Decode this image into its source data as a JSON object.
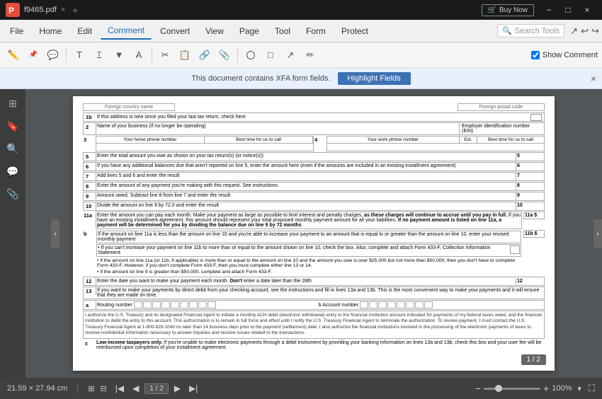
{
  "titleBar": {
    "appName": "f9465.pdf",
    "buyNowLabel": "Buy Now",
    "closeTab": "×",
    "newTab": "+",
    "minLabel": "−",
    "maxLabel": "□",
    "closeLabel": "×"
  },
  "menuBar": {
    "items": [
      {
        "id": "file",
        "label": "File"
      },
      {
        "id": "home",
        "label": "Home"
      },
      {
        "id": "edit",
        "label": "Edit"
      },
      {
        "id": "comment",
        "label": "Comment",
        "active": true
      },
      {
        "id": "convert",
        "label": "Convert"
      },
      {
        "id": "view",
        "label": "View"
      },
      {
        "id": "page",
        "label": "Page"
      },
      {
        "id": "tool",
        "label": "Tool"
      },
      {
        "id": "form",
        "label": "Form"
      },
      {
        "id": "protect",
        "label": "Protect"
      }
    ],
    "searchPlaceholder": "Search Tools"
  },
  "toolbar": {
    "showCommentLabel": "Show Comment"
  },
  "xfaBar": {
    "message": "This document contains XFA form fields.",
    "highlightLabel": "Highlight Fields",
    "closeLabel": "×"
  },
  "pdfContent": {
    "foreignCountry": "Foreign country name",
    "foreignPostal": "Foreign postal code",
    "rows": [
      {
        "num": "1b",
        "text": "If this address is new since you filed your last tax return, check here"
      },
      {
        "num": "2",
        "text": "Name of your business (if no longer be operating)",
        "rightLabel": "Employer identification number (EIN)"
      }
    ],
    "phoneSection": {
      "col1": "Your home phone number",
      "col2": "Best time for us to call",
      "col3": "Your work phone number",
      "col4": "Ext.",
      "col5": "Best time for us to call",
      "rowNum": "3",
      "col4num": "4"
    },
    "formRows": [
      {
        "num": "5",
        "text": "Enter the total amount you owe as shown on your tax return(s) (or notice(s))"
      },
      {
        "num": "6",
        "text": "If you have any additional balances due that aren't reported on line 5, enter the amount here (even if the amounts are included in an existing installment agreement)"
      },
      {
        "num": "7",
        "text": "Add lines 5 and 6 and enter the result"
      },
      {
        "num": "8",
        "text": "Enter the amount of any payment you're making with this request. See instructions"
      },
      {
        "num": "9",
        "text": "Amount owed. Subtract line 8 from line 7 and enter the result"
      },
      {
        "num": "10",
        "text": "Divide the amount on line 9 by 72.0 and enter the result"
      }
    ],
    "row11a": {
      "num": "11a",
      "text": "Enter the amount you can pay each month. Make your payment as large as possible to limit interest and penalty charges, as these charges will continue to accrue until you pay in full. If you have an existing installment agreement, this amount should represent your total proposed monthly payment amount for all your liabilities. If no payment amount is listed on line 11a, a payment will be determined for you by dividing the balance due on line 9 by 72 months"
    },
    "row11b": {
      "num": "b",
      "text": "If the amount on line 11a is less than the amount on line 10 and you're able to increase your payment to an amount that is equal to or greater than the amount on line 10, enter your revised monthly payment",
      "bullets": [
        "• If you can't increase your payment on line 11b to more than or equal to the amount shown on line 10, check the box. Also, complete and attach Form 433-F, Collection Information Statement",
        "• If the amount on line 11a (or 11b, if applicable) is more than or equal to the amount on line 10 and the amount you owe is over $25,000 but not more than $50,000, then you don't have to complete Form 433-F. However, if you don't complete Form 433-F, then you must complete either line 13 or 14.",
        "• If the amount on line 9 is greater than $50,000, complete and attach Form 433-F."
      ]
    },
    "row12": {
      "num": "12",
      "text": "Enter the date you want to make your payment each month. Don't enter a date later than the 28th"
    },
    "row13": {
      "num": "13",
      "text": "If you want to make your payments by direct debit from your checking account, see the instructions and fill in lines 13a and 13b. This is the most convenient way to make your payments and it will ensure that they are made on time."
    },
    "row13a": {
      "label": "a",
      "routingLabel": "Routing number",
      "accountLabel": "b   Account number"
    },
    "authText": "I authorize the U.S. Treasury and its designated Financial Agent to initiate a monthly ACH debit (electronic withdrawal) entry to the financial institution account indicated for payments of my federal taxes owed, and the financial institution to debit the entry to this account. This authorization is to remain in full force and effect until I notify the U.S. Treasury Financial Agent to terminate the authorization. To revoke payment, I must contact the U.S. Treasury Financial Agent at 1-800-829-1040 no later than 14 business days prior to the payment (settlement) date. I also authorize the financial institutions involved in the processing of the electronic payments of taxes to receive confidential information necessary to answer inquiries and resolve issues related to the transactions.",
    "row13c": {
      "label": "c",
      "text": "Low-income taxpayers only. If you're unable to make electronic payments through a debit instrument by providing your banking information on lines 13a and 13b, check this box and your user fee will be reimbursed upon completion of your installment agreement."
    }
  },
  "statusBar": {
    "pageSize": "21.59 × 27.94 cm",
    "currentPage": "1",
    "totalPages": "2",
    "pageDisplay": "1 / 2",
    "zoomLevel": "100%"
  },
  "pageBadge": "1 / 2"
}
